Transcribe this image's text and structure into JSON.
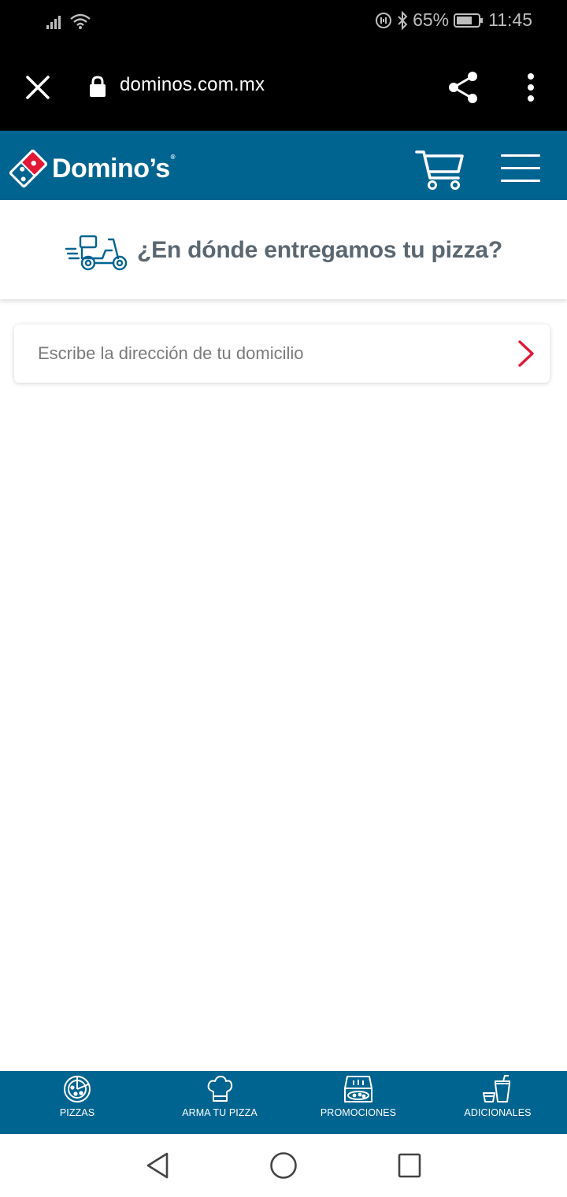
{
  "status_bar": {
    "battery": "65%",
    "time": "11:45"
  },
  "browser": {
    "url": "dominos.com.mx"
  },
  "header": {
    "logo_text": "Domino’s",
    "logo_reg": "®"
  },
  "delivery": {
    "title": "¿En dónde entregamos tu pizza?"
  },
  "address": {
    "placeholder": "Escribe la dirección de tu domicilio",
    "value": ""
  },
  "bottom_nav": {
    "items": [
      {
        "label": "PIZZAS",
        "icon": "pizza-icon"
      },
      {
        "label": "ARMA TU PIZZA",
        "icon": "chef-hat-icon"
      },
      {
        "label": "PROMOCIONES",
        "icon": "pizza-box-icon"
      },
      {
        "label": "ADICIONALES",
        "icon": "drinks-icon"
      }
    ]
  },
  "colors": {
    "brand_blue": "#006491",
    "brand_red": "#e31837",
    "banner_text": "#5b6770"
  }
}
